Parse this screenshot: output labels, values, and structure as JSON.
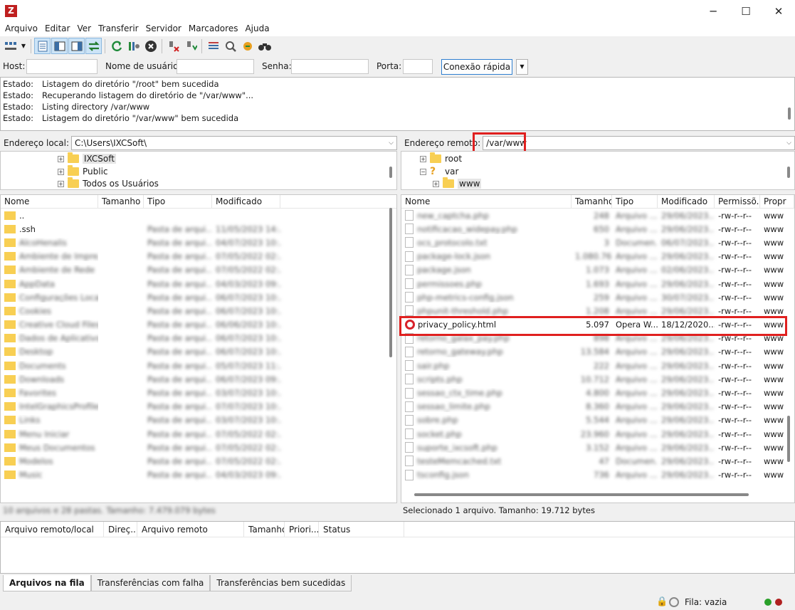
{
  "window": {
    "app_icon": "Z",
    "minimize": "─",
    "maximize": "☐",
    "close": "✕"
  },
  "menu": [
    "Arquivo",
    "Editar",
    "Ver",
    "Transferir",
    "Servidor",
    "Marcadores",
    "Ajuda"
  ],
  "toolbar": {
    "icons": [
      "site-manager-icon",
      "dropdown-arrow-icon",
      "toggle-log-icon",
      "toggle-local-tree-icon",
      "toggle-remote-tree-icon",
      "toggle-queue-icon",
      "refresh-icon",
      "process-queue-icon",
      "cancel-icon",
      "disconnect-icon",
      "reconnect-icon",
      "filter-icon",
      "compare-icon",
      "sync-browse-icon",
      "search-icon"
    ]
  },
  "quickconnect": {
    "host_label": "Host:",
    "host_value": "",
    "user_label": "Nome de usuário:",
    "user_value": "",
    "pass_label": "Senha:",
    "pass_value": "",
    "port_label": "Porta:",
    "port_value": "",
    "connect_button": "Conexão rápida"
  },
  "log": [
    {
      "label": "Estado:",
      "text": "Listagem do diretório \"/root\" bem sucedida"
    },
    {
      "label": "Estado:",
      "text": "Recuperando listagem do diretório de \"/var/www\"..."
    },
    {
      "label": "Estado:",
      "text": "Listing directory /var/www"
    },
    {
      "label": "Estado:",
      "text": "Listagem do diretório \"/var/www\" bem sucedida"
    }
  ],
  "local": {
    "address_label": "Endereço local:",
    "address_value": "C:\\Users\\IXCSoft\\",
    "tree": [
      "IXCSoft",
      "Public",
      "Todos os Usuários"
    ],
    "columns": [
      "Nome",
      "Tamanho",
      "Tipo",
      "Modificado"
    ],
    "rows": [
      {
        "name": "..",
        "size": "",
        "type": "",
        "mod": ""
      },
      {
        "name": ".ssh",
        "size": "",
        "type": "Pasta de arqui...",
        "mod": "11/05/2023 14:..."
      },
      {
        "name": "AlcoHenalis",
        "size": "",
        "type": "Pasta de arqui...",
        "mod": "04/07/2023 10:..."
      },
      {
        "name": "Ambiente de Impre...",
        "size": "",
        "type": "Pasta de arqui...",
        "mod": "07/05/2022 02:..."
      },
      {
        "name": "Ambiente de Rede",
        "size": "",
        "type": "Pasta de arqui...",
        "mod": "07/05/2022 02:..."
      },
      {
        "name": "AppData",
        "size": "",
        "type": "Pasta de arqui...",
        "mod": "04/03/2023 09:..."
      },
      {
        "name": "Configurações Locais",
        "size": "",
        "type": "Pasta de arqui...",
        "mod": "06/07/2023 10:..."
      },
      {
        "name": "Cookies",
        "size": "",
        "type": "Pasta de arqui...",
        "mod": "06/07/2023 10:..."
      },
      {
        "name": "Creative Cloud Files",
        "size": "",
        "type": "Pasta de arqui...",
        "mod": "06/06/2023 10:..."
      },
      {
        "name": "Dados de Aplicativos",
        "size": "",
        "type": "Pasta de arqui...",
        "mod": "06/07/2023 10:..."
      },
      {
        "name": "Desktop",
        "size": "",
        "type": "Pasta de arqui...",
        "mod": "06/07/2023 10:..."
      },
      {
        "name": "Documents",
        "size": "",
        "type": "Pasta de arqui...",
        "mod": "05/07/2023 11:..."
      },
      {
        "name": "Downloads",
        "size": "",
        "type": "Pasta de arqui...",
        "mod": "06/07/2023 09:..."
      },
      {
        "name": "Favorites",
        "size": "",
        "type": "Pasta de arqui...",
        "mod": "03/07/2023 10:..."
      },
      {
        "name": "IntelGraphicsProfiles",
        "size": "",
        "type": "Pasta de arqui...",
        "mod": "07/07/2023 10:..."
      },
      {
        "name": "Links",
        "size": "",
        "type": "Pasta de arqui...",
        "mod": "03/07/2023 10:..."
      },
      {
        "name": "Menu Iniciar",
        "size": "",
        "type": "Pasta de arqui...",
        "mod": "07/05/2022 02:..."
      },
      {
        "name": "Meus Documentos",
        "size": "",
        "type": "Pasta de arqui...",
        "mod": "07/05/2022 02:..."
      },
      {
        "name": "Modelos",
        "size": "",
        "type": "Pasta de arqui...",
        "mod": "07/05/2022 02:..."
      },
      {
        "name": "Music",
        "size": "",
        "type": "Pasta de arqui...",
        "mod": "04/03/2023 09:..."
      }
    ],
    "status": "10 arquivos e 28 pastas. Tamanho: 7.479.079 bytes"
  },
  "remote": {
    "address_label": "Endereço remoto:",
    "address_value": "/var/www",
    "tree": [
      "root",
      "var",
      "www"
    ],
    "columns": [
      "Nome",
      "Tamanho",
      "Tipo",
      "Modificado",
      "Permissõ...",
      "Propr"
    ],
    "rows": [
      {
        "name": "new_captcha.php",
        "size": "248",
        "type": "Arquivo ...",
        "mod": "29/06/2023...",
        "perm": "-rw-r--r--",
        "owner": "www",
        "blur": true
      },
      {
        "name": "notificacao_widepay.php",
        "size": "650",
        "type": "Arquivo ...",
        "mod": "29/06/2023...",
        "perm": "-rw-r--r--",
        "owner": "www",
        "blur": true
      },
      {
        "name": "ocs_protocolo.txt",
        "size": "3",
        "type": "Documen...",
        "mod": "06/07/2023...",
        "perm": "-rw-r--r--",
        "owner": "www",
        "blur": true
      },
      {
        "name": "package-lock.json",
        "size": "1.080.764",
        "type": "Arquivo ...",
        "mod": "29/06/2023...",
        "perm": "-rw-r--r--",
        "owner": "www",
        "blur": true
      },
      {
        "name": "package.json",
        "size": "1.073",
        "type": "Arquivo ...",
        "mod": "02/06/2023...",
        "perm": "-rw-r--r--",
        "owner": "www",
        "blur": true
      },
      {
        "name": "permissoes.php",
        "size": "1.693",
        "type": "Arquivo ...",
        "mod": "29/06/2023...",
        "perm": "-rw-r--r--",
        "owner": "www",
        "blur": true
      },
      {
        "name": "php-metrics-config.json",
        "size": "259",
        "type": "Arquivo ...",
        "mod": "30/07/2023...",
        "perm": "-rw-r--r--",
        "owner": "www",
        "blur": true
      },
      {
        "name": "phpunit-threshold.php",
        "size": "1.208",
        "type": "Arquivo ...",
        "mod": "29/06/2023...",
        "perm": "-rw-r--r--",
        "owner": "www",
        "blur": true
      },
      {
        "name": "privacy_policy.html",
        "size": "5.097",
        "type": "Opera W...",
        "mod": "18/12/2020...",
        "perm": "-rw-r--r--",
        "owner": "www",
        "blur": false
      },
      {
        "name": "retorno_galax_pay.php",
        "size": "898",
        "type": "Arquivo ...",
        "mod": "29/06/2023...",
        "perm": "-rw-r--r--",
        "owner": "www",
        "blur": true
      },
      {
        "name": "retorno_gateway.php",
        "size": "13.584",
        "type": "Arquivo ...",
        "mod": "29/06/2023...",
        "perm": "-rw-r--r--",
        "owner": "www",
        "blur": true
      },
      {
        "name": "sair.php",
        "size": "222",
        "type": "Arquivo ...",
        "mod": "29/06/2023...",
        "perm": "-rw-r--r--",
        "owner": "www",
        "blur": true
      },
      {
        "name": "scripts.php",
        "size": "10.712",
        "type": "Arquivo ...",
        "mod": "29/06/2023...",
        "perm": "-rw-r--r--",
        "owner": "www",
        "blur": true
      },
      {
        "name": "sessao_ctx_time.php",
        "size": "4.800",
        "type": "Arquivo ...",
        "mod": "29/06/2023...",
        "perm": "-rw-r--r--",
        "owner": "www",
        "blur": true
      },
      {
        "name": "sessao_limite.php",
        "size": "8.360",
        "type": "Arquivo ...",
        "mod": "29/06/2023...",
        "perm": "-rw-r--r--",
        "owner": "www",
        "blur": true
      },
      {
        "name": "sobre.php",
        "size": "5.544",
        "type": "Arquivo ...",
        "mod": "29/06/2023...",
        "perm": "-rw-r--r--",
        "owner": "www",
        "blur": true
      },
      {
        "name": "socket.php",
        "size": "23.960",
        "type": "Arquivo ...",
        "mod": "29/06/2023...",
        "perm": "-rw-r--r--",
        "owner": "www",
        "blur": true
      },
      {
        "name": "suporte_ixcsoft.php",
        "size": "3.152",
        "type": "Arquivo ...",
        "mod": "29/06/2023...",
        "perm": "-rw-r--r--",
        "owner": "www",
        "blur": true
      },
      {
        "name": "testeMemcached.txt",
        "size": "47",
        "type": "Documen...",
        "mod": "29/06/2023...",
        "perm": "-rw-r--r--",
        "owner": "www",
        "blur": true
      },
      {
        "name": "tsconfig.json",
        "size": "736",
        "type": "Arquivo ...",
        "mod": "29/06/2023...",
        "perm": "-rw-r--r--",
        "owner": "www",
        "blur": true
      }
    ],
    "status": "Selecionado 1 arquivo. Tamanho: 19.712 bytes"
  },
  "queue": {
    "columns": [
      "Arquivo remoto/local",
      "Direç...",
      "Arquivo remoto",
      "Tamanho",
      "Priori...",
      "Status"
    ]
  },
  "tabs": [
    "Arquivos na fila",
    "Transferências com falha",
    "Transferências bem sucedidas"
  ],
  "statusbar": {
    "queue": "Fila: vazia"
  },
  "colors": {
    "highlight": "#e0201f",
    "folder": "#f8cf53",
    "accent": "#2f7fd0"
  }
}
